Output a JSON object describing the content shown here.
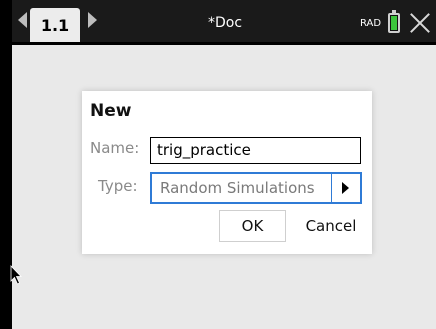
{
  "topbar": {
    "tab_label": "1.1",
    "doc_title": "*Doc",
    "angle_mode": "RAD",
    "battery_level": 0.85,
    "battery_color": "#3cc43c"
  },
  "dialog": {
    "title": "New",
    "name_label": "Name:",
    "name_value": "trig_practice",
    "type_label": "Type:",
    "type_value": "Random Simulations",
    "ok_label": "OK",
    "cancel_label": "Cancel",
    "accent_color": "#2f7bd6"
  },
  "icons": {
    "prev": "triangle-left-icon",
    "next": "triangle-right-icon",
    "battery": "battery-icon",
    "close": "close-icon",
    "dropdown": "triangle-right-icon",
    "cursor": "mouse-pointer-icon"
  }
}
